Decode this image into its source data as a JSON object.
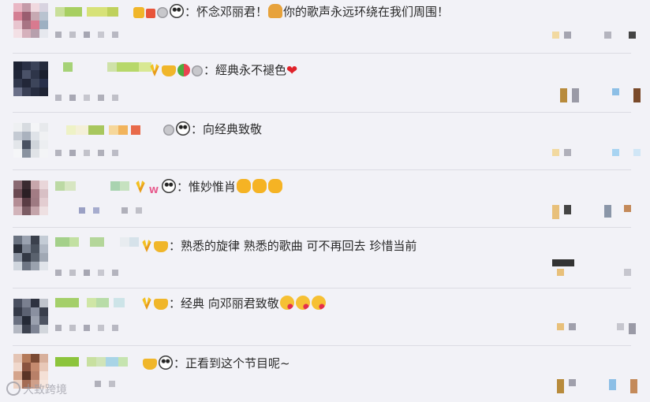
{
  "comments": [
    {
      "prefix": "：",
      "text": "怀念邓丽君！",
      "after": "你的歌声永远环绕在我们周围！"
    },
    {
      "prefix": "：",
      "text": "經典永不褪色"
    },
    {
      "prefix": "：",
      "text": "向经典致敬"
    },
    {
      "prefix": "：",
      "text": "惟妙惟肖"
    },
    {
      "prefix": "：",
      "text": "熟悉的旋律 熟悉的歌曲 可不再回去 珍惜当前"
    },
    {
      "prefix": "：",
      "text": "经典 向邓丽君致敬"
    },
    {
      "prefix": "：",
      "text": "正看到这个节目呢~"
    }
  ],
  "watermark": {
    "text": "大致跨境"
  },
  "colors": {
    "background": "#f2f2f7",
    "text": "#2a2a2a",
    "divider": "#dcdce3"
  },
  "icons": [
    "panda-emoji-icon",
    "pray-emoji-icon",
    "heart-emoji-icon",
    "clap-emoji-icon",
    "kiss-emoji-icon",
    "medal-badge-icon",
    "watermelon-badge-icon",
    "vip-badge-icon"
  ]
}
